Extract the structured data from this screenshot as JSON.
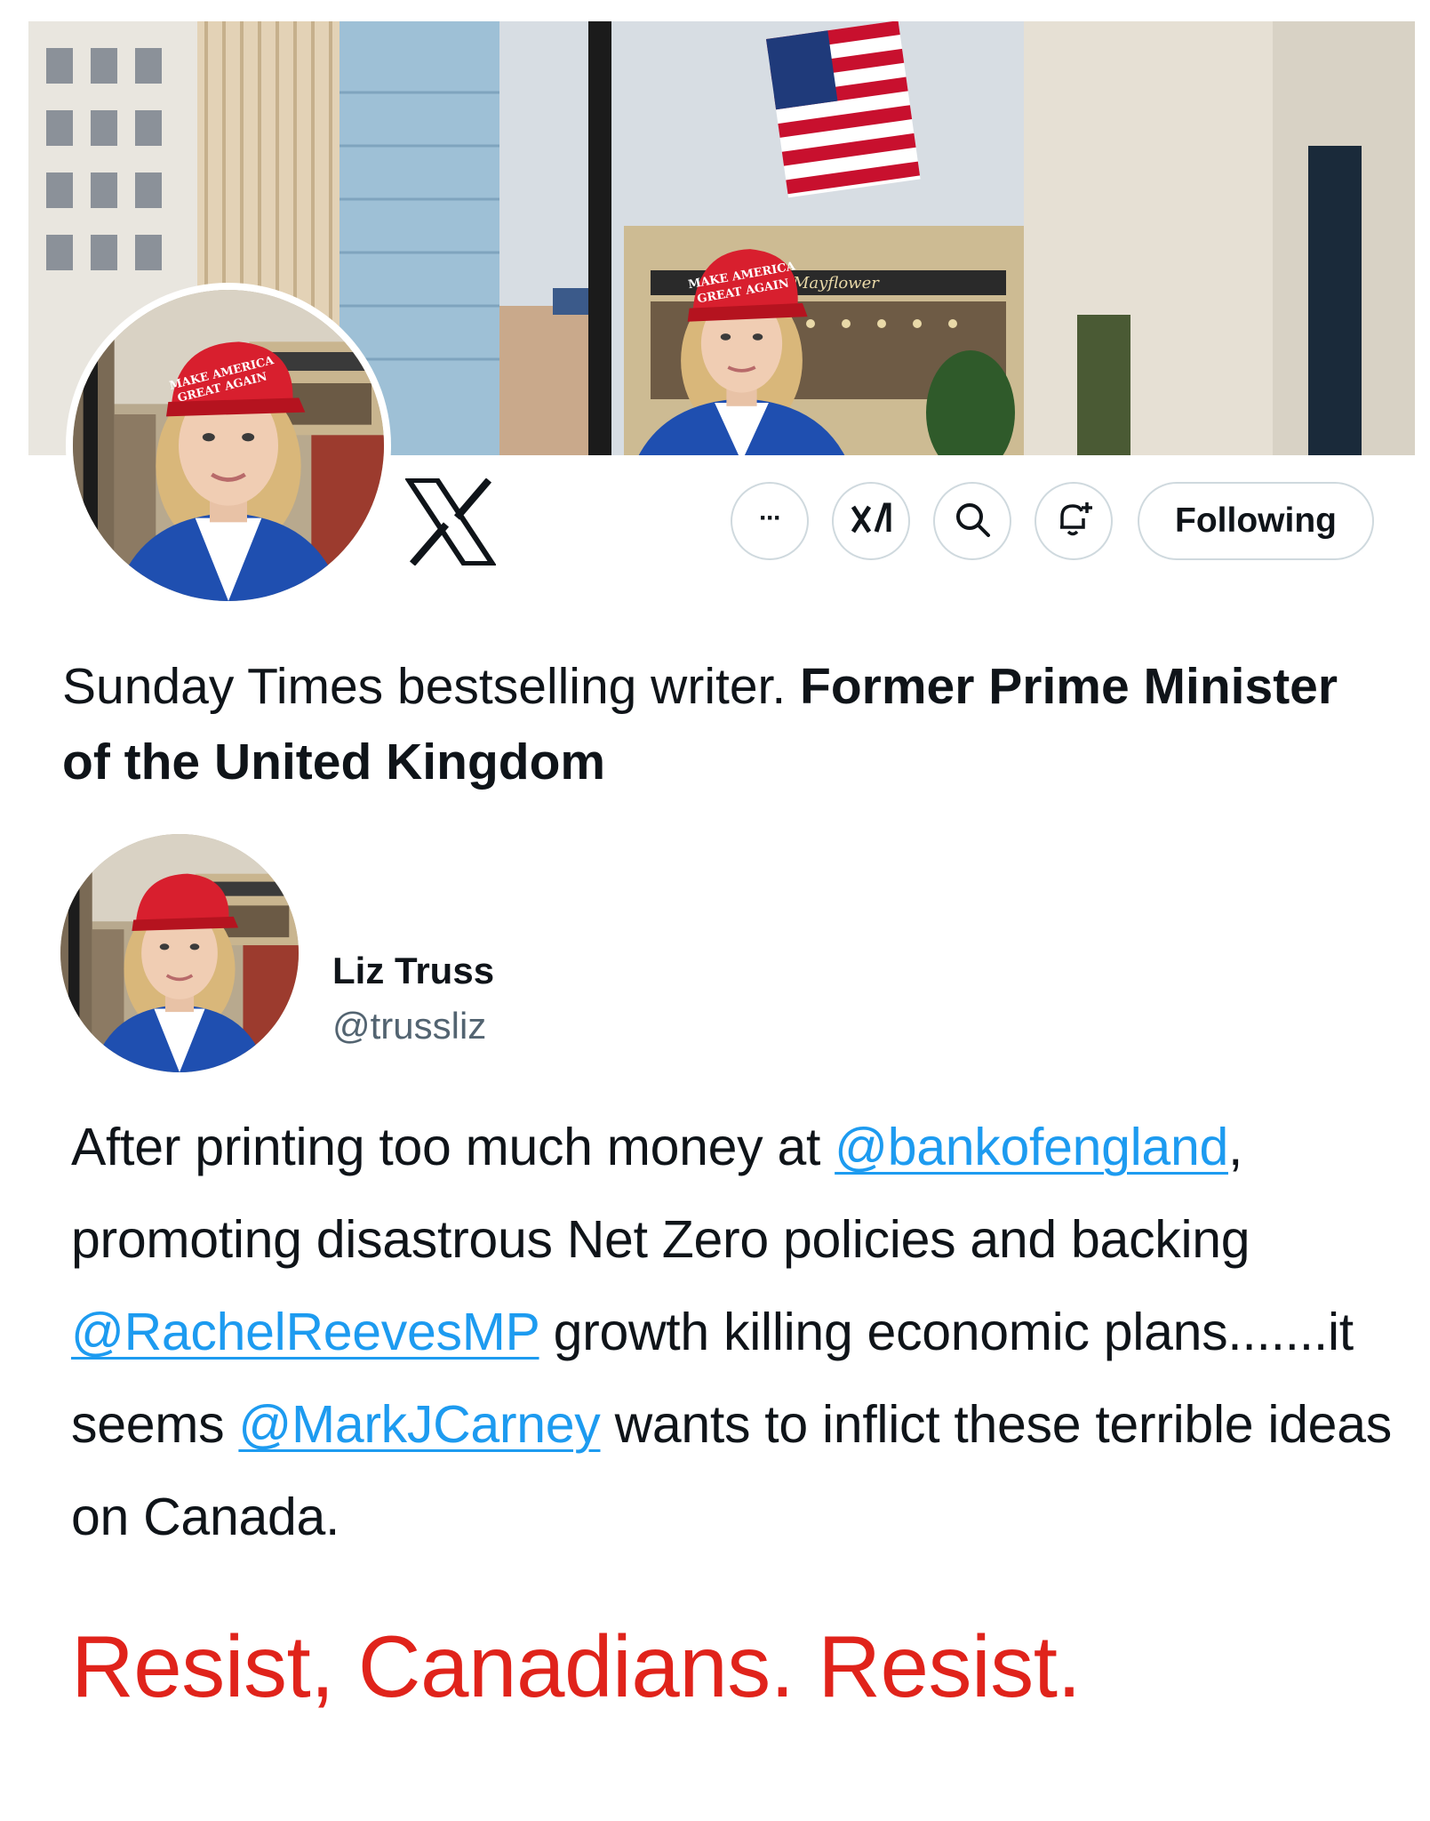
{
  "profile": {
    "bio_regular": "Sunday Times bestselling writer. ",
    "bio_bold": "Former Prime Minister of the United Kingdom",
    "header_buttons": {
      "more_label": "···",
      "grok_label": "xAI",
      "follow_label": "Following"
    }
  },
  "photo_signage": {
    "cap_line1": "MAKE AMERICA",
    "cap_line2": "GREAT AGAIN",
    "hotel_sign": "Mayflower"
  },
  "tweet": {
    "author_name": "Liz Truss",
    "author_handle": "@trussliz",
    "text_1": "After printing too much money at ",
    "mention_1": "@bankofengland",
    "text_2": ", promoting disastrous Net Zero policies and backing ",
    "mention_2": "@RachelReevesMP",
    "text_3": " growth killing economic plans.......it seems ",
    "mention_3": "@MarkJCarney",
    "text_4": " wants to inflict these terrible ideas on Canada."
  },
  "caption": {
    "text": "Resist, Canadians. Resist."
  },
  "colors": {
    "link": "#1d9bf0",
    "caption": "#e0231b",
    "handle": "#536471",
    "border": "#cfd9de"
  },
  "icons": [
    "x-logo-icon",
    "more-icon",
    "grok-icon",
    "search-icon",
    "notification-bell-icon"
  ]
}
